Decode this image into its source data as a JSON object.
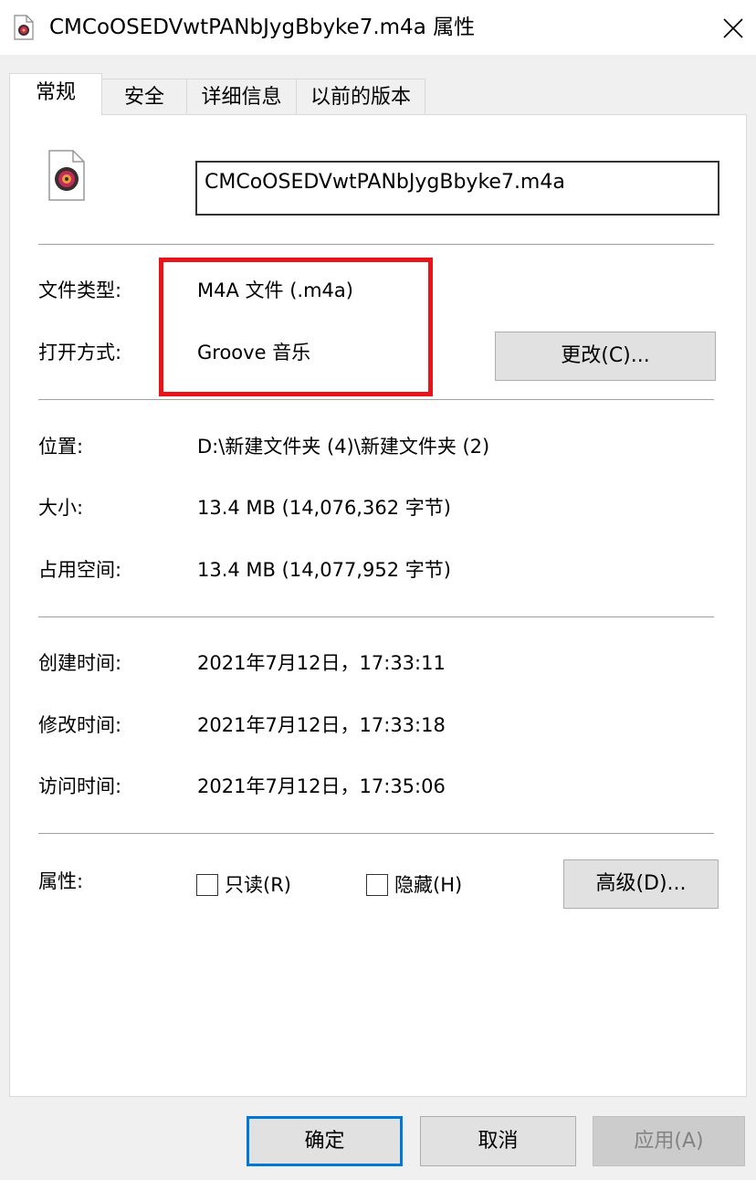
{
  "window": {
    "title": "CMCoOSEDVwtPANbJygBbyke7.m4a 属性",
    "close_icon": "close-icon"
  },
  "tabs": [
    {
      "label": "常规",
      "active": true
    },
    {
      "label": "安全",
      "active": false
    },
    {
      "label": "详细信息",
      "active": false
    },
    {
      "label": "以前的版本",
      "active": false
    }
  ],
  "file": {
    "icon": "audio-file-icon",
    "name": "CMCoOSEDVwtPANbJygBbyke7.m4a"
  },
  "type_section": {
    "type_label": "文件类型:",
    "type_value": "M4A 文件 (.m4a)",
    "opens_label": "打开方式:",
    "opens_value": "Groove 音乐",
    "change_button": "更改(C)..."
  },
  "location_section": {
    "location_label": "位置:",
    "location_value": "D:\\新建文件夹 (4)\\新建文件夹 (2)",
    "size_label": "大小:",
    "size_value": "13.4 MB (14,076,362 字节)",
    "disk_label": "占用空间:",
    "disk_value": "13.4 MB (14,077,952 字节)"
  },
  "time_section": {
    "created_label": "创建时间:",
    "created_value": "2021年7月12日，17:33:11",
    "modified_label": "修改时间:",
    "modified_value": "2021年7月12日，17:33:18",
    "accessed_label": "访问时间:",
    "accessed_value": "2021年7月12日，17:35:06"
  },
  "attributes": {
    "label": "属性:",
    "readonly": {
      "label": "只读(R)",
      "checked": false
    },
    "hidden": {
      "label": "隐藏(H)",
      "checked": false
    },
    "advanced_button": "高级(D)..."
  },
  "footer": {
    "ok": "确定",
    "cancel": "取消",
    "apply": "应用(A)"
  },
  "colors": {
    "highlight_border": "#e8141a",
    "focus_blue": "#0078d7"
  }
}
